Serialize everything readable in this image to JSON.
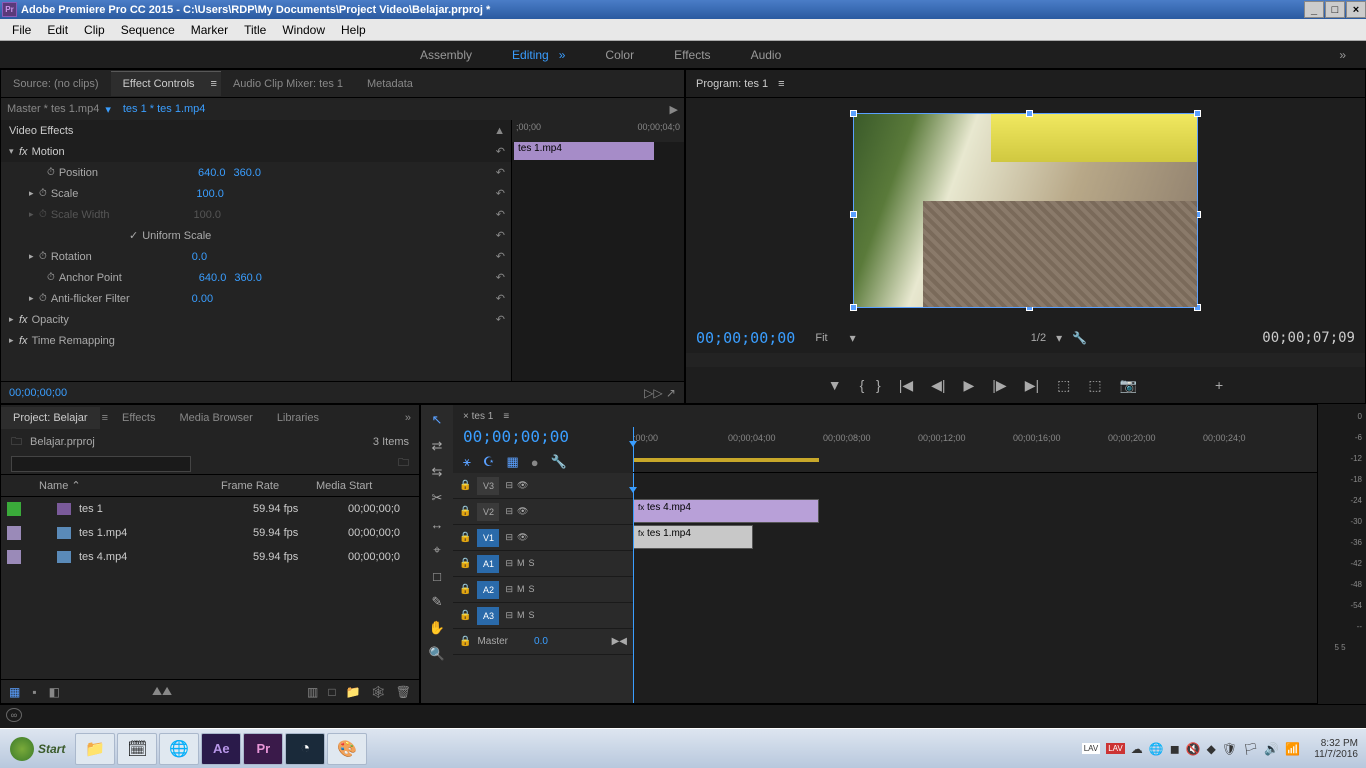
{
  "window": {
    "title": "Adobe Premiere Pro CC 2015 - C:\\Users\\RDP\\My Documents\\Project Video\\Belajar.prproj *",
    "app_icon": "Pr"
  },
  "menubar": [
    "File",
    "Edit",
    "Clip",
    "Sequence",
    "Marker",
    "Title",
    "Window",
    "Help"
  ],
  "workspaces": {
    "items": [
      "Assembly",
      "Editing",
      "Color",
      "Effects",
      "Audio"
    ],
    "active": 1,
    "menu": "»"
  },
  "source_tabs": {
    "items": [
      "Source: (no clips)",
      "Effect Controls",
      "Audio Clip Mixer: tes 1",
      "Metadata"
    ],
    "active": 1,
    "menu": "≡"
  },
  "effect_controls": {
    "master": "Master * tes 1.mp4",
    "link": "tes 1 * tes 1.mp4",
    "arrow": "▶",
    "section": "Video Effects",
    "motion": {
      "label": "Motion",
      "position": {
        "label": "Position",
        "x": "640.0",
        "y": "360.0"
      },
      "scale": {
        "label": "Scale",
        "val": "100.0"
      },
      "scale_width": {
        "label": "Scale Width",
        "val": "100.0"
      },
      "uniform": {
        "label": "Uniform Scale",
        "checked": "✓"
      },
      "rotation": {
        "label": "Rotation",
        "val": "0.0"
      },
      "anchor": {
        "label": "Anchor Point",
        "x": "640.0",
        "y": "360.0"
      },
      "antiflicker": {
        "label": "Anti-flicker Filter",
        "val": "0.00"
      }
    },
    "opacity": "Opacity",
    "time_remap": "Time Remapping",
    "timecode": "00;00;00;00",
    "ruler": {
      "start": ";00;00",
      "end": "00;00;04;0"
    },
    "clip": "tes 1.mp4"
  },
  "program": {
    "tab": "Program: tes 1",
    "menu": "≡",
    "timecode": "00;00;00;00",
    "fit": "Fit",
    "half": "1/2",
    "duration": "00;00;07;09",
    "transport": [
      "❤",
      "{ }",
      "▮",
      "◄◄",
      "◀",
      "▶",
      "▶▶",
      "►►",
      "⎘",
      "⎙",
      "📷",
      "+"
    ]
  },
  "project": {
    "tabs": [
      "Project: Belajar",
      "Effects",
      "Media Browser",
      "Libraries"
    ],
    "menu": "≡",
    "more": "»",
    "file": "Belajar.prproj",
    "items": "3 Items",
    "search_placeholder": "",
    "cols": {
      "name": "Name",
      "frame": "Frame Rate",
      "start": "Media Start",
      "sort": "⌃"
    },
    "rows": [
      {
        "color": "#3aaa3a",
        "type": "seq",
        "name": "tes 1",
        "fps": "59.94 fps",
        "start": "00;00;00;0"
      },
      {
        "color": "#9a8ab8",
        "type": "clip",
        "name": "tes 1.mp4",
        "fps": "59.94 fps",
        "start": "00;00;00;0"
      },
      {
        "color": "#9a8ab8",
        "type": "clip",
        "name": "tes 4.mp4",
        "fps": "59.94 fps",
        "start": "00;00;00;0"
      }
    ],
    "footer_left": [
      "▦",
      "▪",
      "◧"
    ],
    "footer_slider": "⛰⛰",
    "footer_right": [
      "▥",
      "□",
      "📁",
      "🕸",
      "🗑"
    ]
  },
  "timeline": {
    "tools": [
      "↖",
      "⇄",
      "⇆",
      "✂",
      "↔",
      "⌖",
      "□",
      "✎",
      "✋",
      "🔍"
    ],
    "tab": "× tes 1",
    "menu": "≡",
    "timecode": "00;00;00;00",
    "opts": [
      "⚹",
      "☪",
      "▦",
      "●",
      "🔧"
    ],
    "ruler": [
      ";00;00",
      "00;00;04;00",
      "00;00;08;00",
      "00;00;12;00",
      "00;00;16;00",
      "00;00;20;00",
      "00;00;24;0"
    ],
    "tracks": {
      "video": [
        {
          "lbl": "V3",
          "sel": false
        },
        {
          "lbl": "V2",
          "sel": false
        },
        {
          "lbl": "V1",
          "sel": true
        }
      ],
      "audio": [
        {
          "lbl": "A1",
          "sel": true
        },
        {
          "lbl": "A2",
          "sel": true
        },
        {
          "lbl": "A3",
          "sel": true
        }
      ],
      "master": {
        "lbl": "Master",
        "val": "0.0"
      }
    },
    "clips": {
      "v2": "tes 4.mp4",
      "v1": "tes 1.mp4"
    },
    "track_ops": {
      "sync": "⊟",
      "eye": "👁",
      "m": "M",
      "s": "S",
      "lock": "🔒"
    }
  },
  "audio_meter": [
    "0",
    "-6",
    "-12",
    "-18",
    "-24",
    "-30",
    "-36",
    "-42",
    "-48",
    "-54",
    "--",
    "5 5"
  ],
  "taskbar": {
    "start": "Start",
    "apps": [
      "📁",
      "🗓",
      "🌐",
      "Ae",
      "Pr",
      "◔",
      "🎨"
    ],
    "tray": [
      "LAV",
      "LAV",
      "☁",
      "🌐",
      "◼",
      "🔇",
      "◆",
      "🛡",
      "🏳",
      "🔊",
      "📶"
    ],
    "time": "8:32 PM",
    "date": "11/7/2016"
  }
}
